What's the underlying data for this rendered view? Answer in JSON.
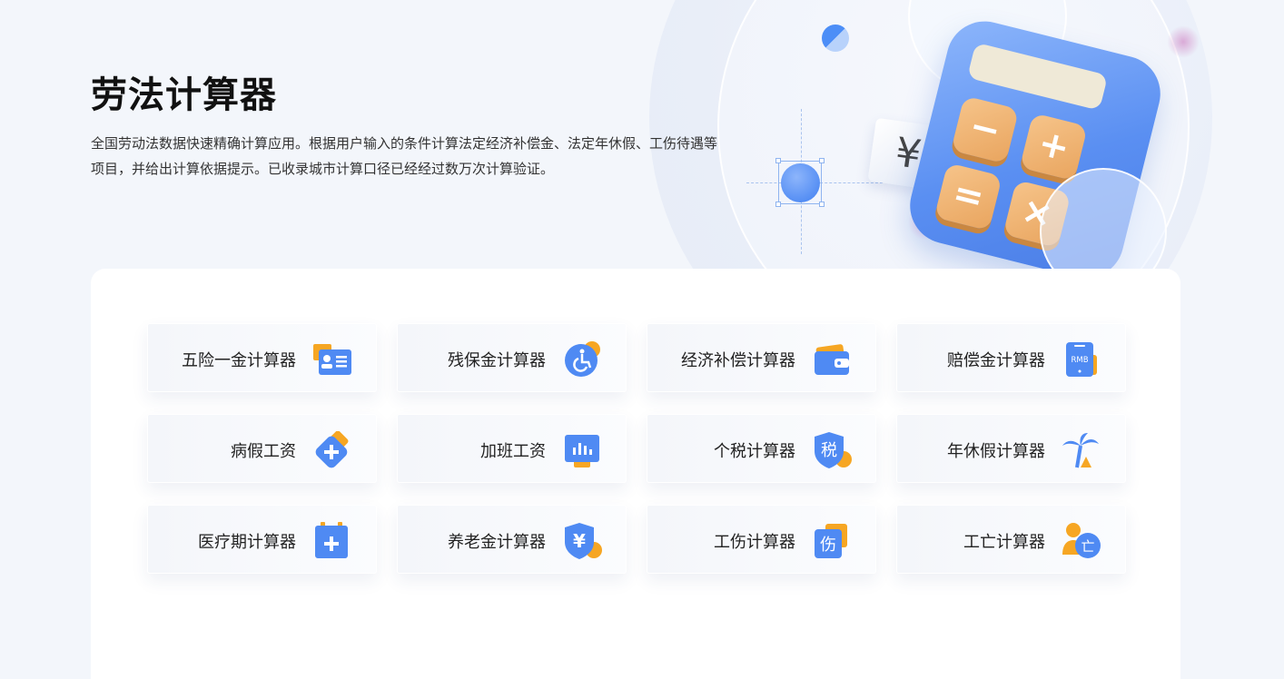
{
  "header": {
    "title": "劳法计算器",
    "description": "全国劳动法数据快速精确计算应用。根据用户输入的条件计算法定经济补偿金、法定年休假、工伤待遇等项目，并给出计算依据提示。已收录城市计算口径已经经过数万次计算验证。"
  },
  "illustration": {
    "currency_symbol": "¥",
    "calculator_keys": [
      "−",
      "+",
      "=",
      "×"
    ]
  },
  "calculators": [
    {
      "label": "五险一金计算器",
      "icon": "id-card-icon"
    },
    {
      "label": "残保金计算器",
      "icon": "wheelchair-icon"
    },
    {
      "label": "经济补偿计算器",
      "icon": "wallet-icon"
    },
    {
      "label": "赔偿金计算器",
      "icon": "rmb-phone-icon",
      "icon_text": "RMB"
    },
    {
      "label": "病假工资",
      "icon": "medical-plus-icon"
    },
    {
      "label": "加班工资",
      "icon": "monitor-chart-icon"
    },
    {
      "label": "个税计算器",
      "icon": "tax-shield-icon",
      "icon_text": "税"
    },
    {
      "label": "年休假计算器",
      "icon": "palm-tree-icon"
    },
    {
      "label": "医疗期计算器",
      "icon": "medical-calendar-icon"
    },
    {
      "label": "养老金计算器",
      "icon": "yen-shield-icon",
      "icon_text": "¥"
    },
    {
      "label": "工伤计算器",
      "icon": "injury-card-icon",
      "icon_text": "伤"
    },
    {
      "label": "工亡计算器",
      "icon": "person-death-icon",
      "icon_text": "亡"
    }
  ],
  "colors": {
    "accent_blue": "#4f8af3",
    "accent_orange": "#f6a623",
    "background": "#f3f6fb"
  }
}
